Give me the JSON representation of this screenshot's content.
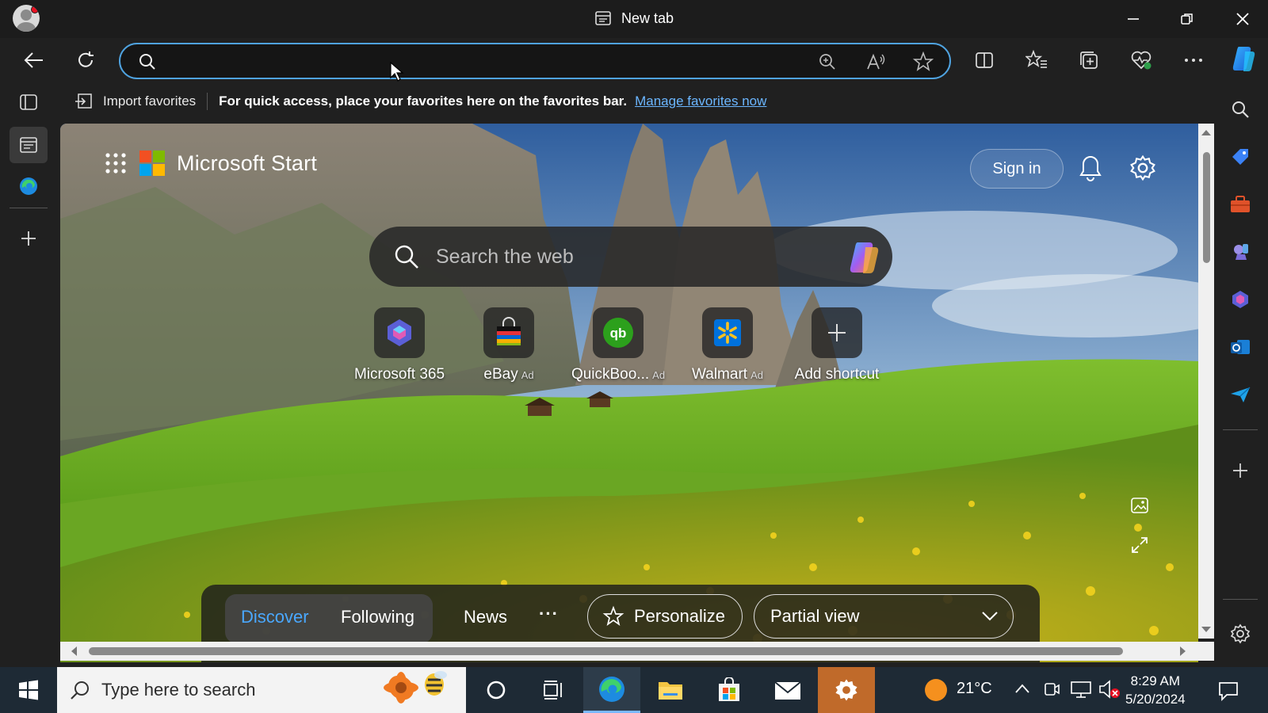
{
  "window": {
    "tab_title": "New tab"
  },
  "address_bar": {
    "value": "",
    "placeholder": ""
  },
  "favorites_bar": {
    "import_label": "Import favorites",
    "message": "For quick access, place your favorites here on the favorites bar.",
    "manage_link": "Manage favorites now"
  },
  "start_page": {
    "brand": "Microsoft Start",
    "sign_in": "Sign in",
    "search_placeholder": "Search the web",
    "shortcuts": [
      {
        "label": "Microsoft 365",
        "ad": ""
      },
      {
        "label": "eBay",
        "ad": "Ad"
      },
      {
        "label": "QuickBoo...",
        "ad": "Ad"
      },
      {
        "label": "Walmart",
        "ad": "Ad"
      },
      {
        "label": "Add shortcut",
        "ad": ""
      }
    ],
    "feed_tabs": [
      "Discover",
      "Following",
      "News"
    ],
    "more": "···",
    "personalize": "Personalize",
    "view_select": "Partial view"
  },
  "taskbar": {
    "search_placeholder": "Type here to search",
    "temperature": "21°C",
    "time": "8:29 AM",
    "date": "5/20/2024"
  },
  "colors": {
    "accent_link": "#6bb6ff",
    "address_focus": "#4fa3e0",
    "discover_active": "#4aa8ff"
  }
}
